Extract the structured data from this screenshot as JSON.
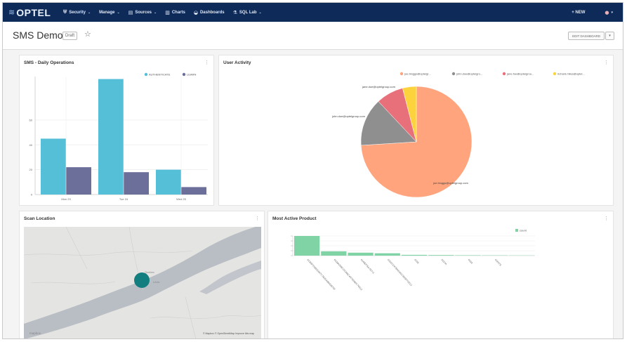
{
  "nav": {
    "logo_text": "OPTEL",
    "items": [
      {
        "label": "Security",
        "icon": "security-icon",
        "caret": true
      },
      {
        "label": "Manage",
        "icon": "",
        "caret": true
      },
      {
        "label": "Sources",
        "icon": "database-icon",
        "caret": true
      },
      {
        "label": "Charts",
        "icon": "bar-chart-icon",
        "caret": false
      },
      {
        "label": "Dashboards",
        "icon": "dashboard-icon",
        "caret": false
      },
      {
        "label": "SQL Lab",
        "icon": "flask-icon",
        "caret": true
      }
    ],
    "new_label": "+ NEW"
  },
  "header": {
    "title": "SMS Demo",
    "status": "Draft",
    "edit_label": "EDIT DASHBOARD"
  },
  "colors": {
    "nav_bg": "#0e2a59",
    "authenticate": "#56bfd8",
    "learn": "#6d6f9b",
    "pie": [
      "#ffa47d",
      "#8f8f8f",
      "#e8707a",
      "#fcd33d"
    ],
    "count": "#7fd3a5",
    "marker": "#137e80"
  },
  "panels": {
    "daily": {
      "title": "SMS - Daily Operations"
    },
    "user": {
      "title": "User Activity"
    },
    "scan": {
      "title": "Scan Location",
      "attribution": "© Mapbox © OpenStreetMap Improve this map",
      "logo": "mapbox",
      "place_labels": [
        "Quebec",
        "Lévis"
      ]
    },
    "product": {
      "title": "Most Active Product"
    }
  },
  "chart_data": [
    {
      "type": "bar",
      "title": "SMS - Daily Operations",
      "categories": [
        "Mon 23",
        "Tue 24",
        "Wed 25"
      ],
      "series": [
        {
          "name": "AUTHENTICATE",
          "values": [
            45,
            93,
            20
          ]
        },
        {
          "name": "LEARN",
          "values": [
            22,
            18,
            6
          ]
        }
      ],
      "ylim": [
        0,
        95
      ],
      "yticks": [
        0,
        20,
        40,
        60
      ],
      "legend": "top-right",
      "grid": true
    },
    {
      "type": "pie",
      "title": "User Activity",
      "legend": "top",
      "legend_labels": [
        "joe.bloggs@opteigr...",
        "john.doe@opteigro...",
        "jane.foe@opteigrou...",
        "richard.miles@optel..."
      ],
      "slices": [
        {
          "name": "joe.bloggs@optelgroup.com",
          "value": 74
        },
        {
          "name": "john.doe@optelgroup.com",
          "value": 14
        },
        {
          "name": "jane.doe@optelgroup.com",
          "value": 8
        },
        {
          "name": "richard.miles@optelgroup.com",
          "value": 4
        }
      ]
    },
    {
      "type": "bar",
      "title": "Most Active Product",
      "series": [
        {
          "name": "count",
          "values": [
            100,
            22,
            15,
            12,
            4,
            3,
            2,
            1.5,
            1
          ]
        }
      ],
      "categories": [
        "0136B7D5B31947C7B2EA88A5B75F",
        "0138A25BCD2349C4A7E0B0C76612",
        "0148DF5A-557-5",
        "0152CD47BA6341C8A9FF0E12",
        "0155",
        "0157A",
        "0159",
        "01607A"
      ],
      "legend": "top-right"
    }
  ]
}
